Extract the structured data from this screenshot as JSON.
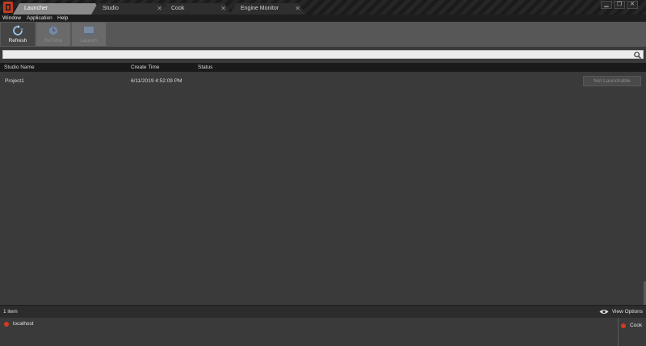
{
  "tabs": [
    {
      "label": "Launcher",
      "active": true
    },
    {
      "label": "Studio",
      "active": false
    },
    {
      "label": "Cook",
      "active": false
    },
    {
      "label": "Engine Monitor",
      "active": false
    }
  ],
  "menu": [
    "Window",
    "Application",
    "Help"
  ],
  "toolbar": {
    "refresh": {
      "label": "Refresh",
      "icon": "refresh-icon",
      "enabled": true
    },
    "retime": {
      "label": "ReTime",
      "icon": "clock-icon",
      "enabled": false
    },
    "launch": {
      "label": "Launch",
      "icon": "monitor-icon",
      "enabled": false
    }
  },
  "search": {
    "value": "",
    "placeholder": ""
  },
  "table": {
    "columns": [
      "Studio Name",
      "Create Time",
      "Status"
    ],
    "rows": [
      {
        "name": "Project1",
        "create_time": "6/11/2019 4:52:09 PM",
        "status": "",
        "action": "Not Launchable"
      }
    ]
  },
  "statusbar": {
    "count": "1 item",
    "view_options": "View Options"
  },
  "hosts": [
    {
      "label": "localhost",
      "state": "offline"
    }
  ],
  "services": [
    {
      "label": "Cook",
      "state": "offline"
    }
  ],
  "colors": {
    "accent": "#d33a1f",
    "active_tab": "#8a8a8a",
    "background": "#3a3a3a"
  }
}
